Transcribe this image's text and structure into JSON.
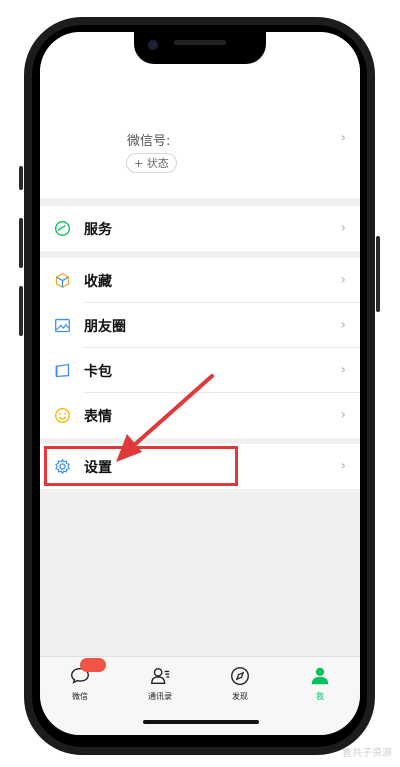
{
  "profile": {
    "wechat_id_label": "微信号:",
    "status_button": "+ 状态"
  },
  "menu": [
    {
      "label": "服务",
      "icon": "service-icon"
    },
    {
      "label": "收藏",
      "icon": "favorites-icon"
    },
    {
      "label": "朋友圈",
      "icon": "moments-icon"
    },
    {
      "label": "卡包",
      "icon": "card-wallet-icon"
    },
    {
      "label": "表情",
      "icon": "sticker-icon"
    },
    {
      "label": "设置",
      "icon": "settings-icon"
    }
  ],
  "tabs": [
    {
      "label": "微信",
      "icon": "chat-icon"
    },
    {
      "label": "通讯录",
      "icon": "contacts-icon"
    },
    {
      "label": "发现",
      "icon": "discover-icon"
    },
    {
      "label": "我",
      "icon": "me-icon",
      "active": true
    }
  ],
  "colors": {
    "accent": "#07c160",
    "annotation": "#e0393b"
  },
  "watermark": "鲁共子资源"
}
